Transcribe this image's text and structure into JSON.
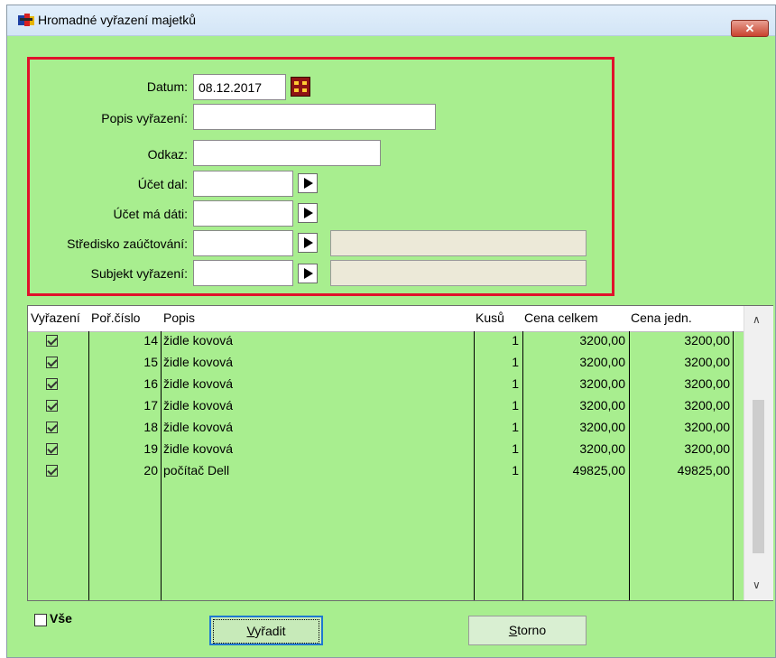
{
  "window": {
    "title": "Hromadné vyřazení majetků",
    "close_label": "✕"
  },
  "form": {
    "datum_label": "Datum:",
    "datum_value": "08.12.2017",
    "popis_label": "Popis vyřazení:",
    "popis_value": "",
    "odkaz_label": "Odkaz:",
    "odkaz_value": "",
    "ucet_dal_label": "Účet dal:",
    "ucet_dal_value": "",
    "ucet_ma_dati_label": "Účet má dáti:",
    "ucet_ma_dati_value": "",
    "stredisko_label": "Středisko zaúčtování:",
    "stredisko_value": "",
    "subjekt_label": "Subjekt vyřazení:",
    "subjekt_value": ""
  },
  "table": {
    "headers": [
      "Vyřazení",
      "Poř.číslo",
      "Popis",
      "Kusů",
      "Cena celkem",
      "Cena jedn."
    ],
    "rows": [
      {
        "checked": true,
        "por_cislo": "14",
        "popis": "židle kovová",
        "kusu": "1",
        "cena_celkem": "3200,00",
        "cena_jedn": "3200,00"
      },
      {
        "checked": true,
        "por_cislo": "15",
        "popis": "židle kovová",
        "kusu": "1",
        "cena_celkem": "3200,00",
        "cena_jedn": "3200,00"
      },
      {
        "checked": true,
        "por_cislo": "16",
        "popis": "židle kovová",
        "kusu": "1",
        "cena_celkem": "3200,00",
        "cena_jedn": "3200,00"
      },
      {
        "checked": true,
        "por_cislo": "17",
        "popis": "židle kovová",
        "kusu": "1",
        "cena_celkem": "3200,00",
        "cena_jedn": "3200,00"
      },
      {
        "checked": true,
        "por_cislo": "18",
        "popis": "židle kovová",
        "kusu": "1",
        "cena_celkem": "3200,00",
        "cena_jedn": "3200,00"
      },
      {
        "checked": true,
        "por_cislo": "19",
        "popis": "židle kovová",
        "kusu": "1",
        "cena_celkem": "3200,00",
        "cena_jedn": "3200,00"
      },
      {
        "checked": true,
        "por_cislo": "20",
        "popis": "počítač Dell",
        "kusu": "1",
        "cena_celkem": "49825,00",
        "cena_jedn": "49825,00"
      }
    ]
  },
  "footer": {
    "vse_label": "Vše",
    "vse_checked": false,
    "vyradit_first": "V",
    "vyradit_rest": "yřadit",
    "storno_first": "S",
    "storno_rest": "torno"
  },
  "colors": {
    "background": "#a8ee8f",
    "highlight_border": "#e0112b",
    "focus_border": "#1f78d1"
  },
  "icons": [
    "app-icon",
    "calendar-icon",
    "arrow-right-icon",
    "close-icon",
    "checkbox-checked-icon",
    "chevron-up-icon",
    "chevron-down-icon"
  ]
}
